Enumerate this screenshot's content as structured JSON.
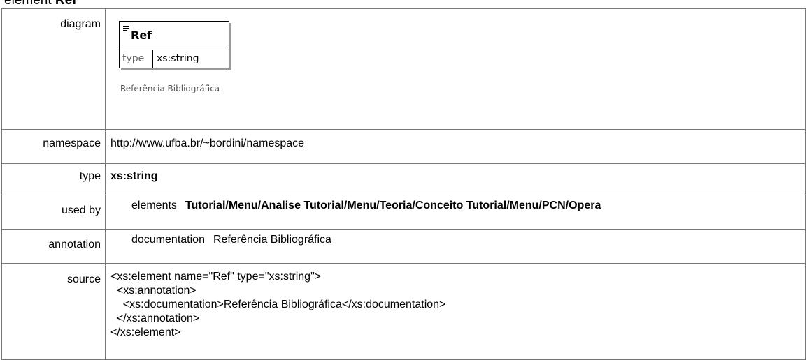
{
  "heading": {
    "prefix": "element",
    "name": "Ref"
  },
  "rows": {
    "diagram": {
      "label": "diagram",
      "element_name": "Ref",
      "type_key": "type",
      "type_value": "xs:string",
      "caption": "Referência Bibliográfica",
      "icon": "element-icon"
    },
    "namespace": {
      "label": "namespace",
      "value": "http://www.ufba.br/~bordini/namespace"
    },
    "type": {
      "label": "type",
      "value": "xs:string"
    },
    "used_by": {
      "label": "used by",
      "key": "elements",
      "value": "Tutorial/Menu/Analise Tutorial/Menu/Teoria/Conceito Tutorial/Menu/PCN/Opera"
    },
    "annotation": {
      "label": "annotation",
      "key": "documentation",
      "value": "Referência Bibliográfica"
    },
    "source": {
      "label": "source",
      "lines": [
        "<xs:element name=\"Ref\" type=\"xs:string\">",
        "  <xs:annotation>",
        "    <xs:documentation>Referência Bibliográfica</xs:documentation>",
        "  </xs:annotation>",
        "</xs:element>"
      ]
    }
  }
}
